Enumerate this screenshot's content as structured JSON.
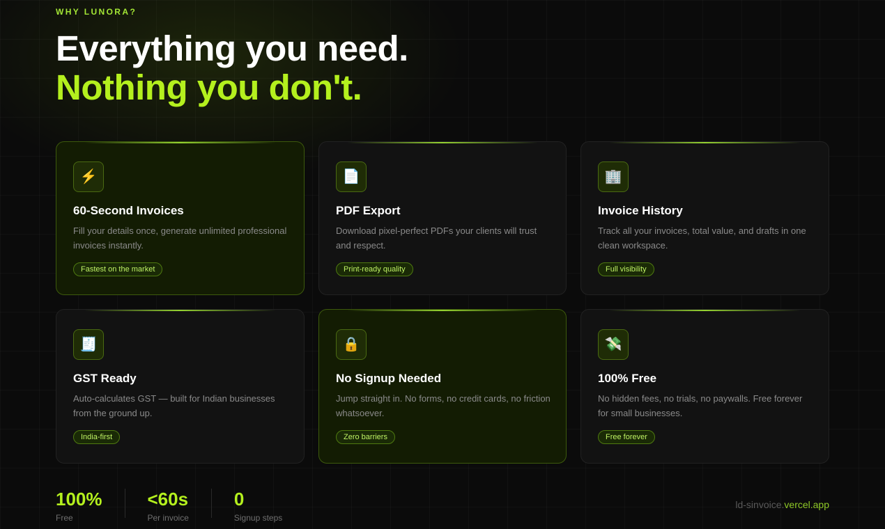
{
  "section": {
    "eyebrow": "WHY LUNORA?",
    "headline_line1": "Everything you need.",
    "headline_line2": "Nothing you don't."
  },
  "colors": {
    "accent": "#b4f01e",
    "background": "#0b0b0b",
    "card": "#121212",
    "card_highlight": "#131c03"
  },
  "features": [
    {
      "icon": "⚡",
      "icon_name": "lightning-icon",
      "title": "60-Second Invoices",
      "description": "Fill your details once, generate unlimited professional invoices instantly.",
      "badge": "Fastest on the market",
      "highlighted": true
    },
    {
      "icon": "📄",
      "icon_name": "document-icon",
      "title": "PDF Export",
      "description": "Download pixel-perfect PDFs your clients will trust and respect.",
      "badge": "Print-ready quality",
      "highlighted": false
    },
    {
      "icon": "🏢",
      "icon_name": "office-building-icon",
      "title": "Invoice History",
      "description": "Track all your invoices, total value, and drafts in one clean workspace.",
      "badge": "Full visibility",
      "highlighted": false
    },
    {
      "icon": "🧾",
      "icon_name": "receipt-icon",
      "title": "GST Ready",
      "description": "Auto-calculates GST — built for Indian businesses from the ground up.",
      "badge": "India-first",
      "highlighted": false
    },
    {
      "icon": "🔒",
      "icon_name": "lock-icon",
      "title": "No Signup Needed",
      "description": "Jump straight in. No forms, no credit cards, no friction whatsoever.",
      "badge": "Zero barriers",
      "highlighted": true
    },
    {
      "icon": "💸",
      "icon_name": "money-with-wings-icon",
      "title": "100% Free",
      "description": "No hidden fees, no trials, no paywalls. Free forever for small businesses.",
      "badge": "Free forever",
      "highlighted": false
    }
  ],
  "stats": [
    {
      "value": "100%",
      "label": "Free"
    },
    {
      "value": "<60s",
      "label": "Per invoice"
    },
    {
      "value": "0",
      "label": "Signup steps"
    }
  ],
  "footer": {
    "domain_prefix": "ld-sinvoice.",
    "domain_suffix": "vercel.app"
  }
}
